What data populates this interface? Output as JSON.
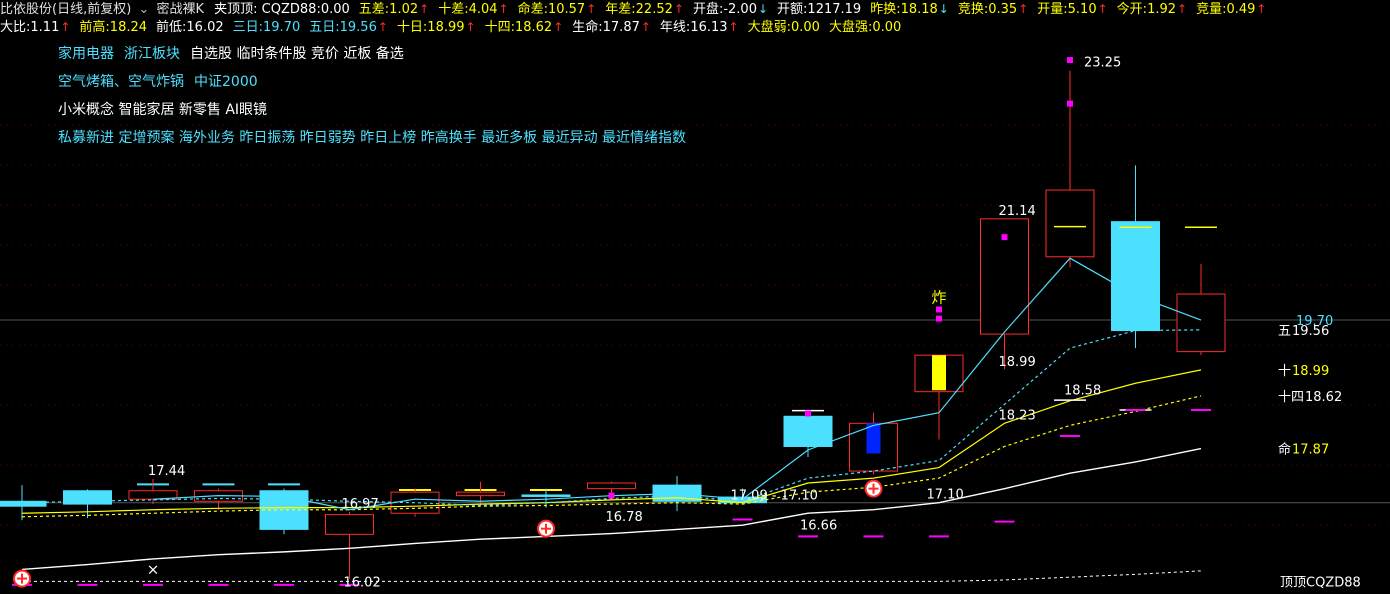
{
  "header": {
    "title": "比依股份(日线,前复权)",
    "indicator_name": "密战裸K",
    "formula_name": "夹顶顶:",
    "row1": [
      {
        "label": "CQZD88:",
        "value": "0.00",
        "color": "#ffffff",
        "arrow": ""
      },
      {
        "label": "五差:",
        "value": "1.02",
        "color": "#ffff00",
        "arrow": "up"
      },
      {
        "label": "十差:",
        "value": "4.04",
        "color": "#ffff00",
        "arrow": "up"
      },
      {
        "label": "命差:",
        "value": "10.57",
        "color": "#ffff00",
        "arrow": "up"
      },
      {
        "label": "年差:",
        "value": "22.52",
        "color": "#ffff00",
        "arrow": "up"
      },
      {
        "label": "开盘:",
        "value": "-2.00",
        "color": "#ffffff",
        "arrow": "down"
      },
      {
        "label": "开额:",
        "value": "1217.19",
        "color": "#ffffff",
        "arrow": ""
      },
      {
        "label": "昨换:",
        "value": "18.18",
        "color": "#ffff00",
        "arrow": "down"
      },
      {
        "label": "竞换:",
        "value": "0.35",
        "color": "#ffff00",
        "arrow": "up"
      },
      {
        "label": "开量:",
        "value": "5.10",
        "color": "#ffff00",
        "arrow": "up"
      },
      {
        "label": "今开:",
        "value": "1.92",
        "color": "#ffff00",
        "arrow": "up"
      },
      {
        "label": "竞量:",
        "value": "0.49",
        "color": "#ffff00",
        "arrow": "up"
      }
    ],
    "row2": [
      {
        "label": "大比:",
        "value": "1.11",
        "color": "#ffffff",
        "arrow": "up"
      },
      {
        "label": "前高:",
        "value": "18.24",
        "color": "#ffff00",
        "arrow": ""
      },
      {
        "label": "前低:",
        "value": "16.02",
        "color": "#ffffff",
        "arrow": ""
      },
      {
        "label": "三日:",
        "value": "19.70",
        "color": "#4ce0ff",
        "arrow": ""
      },
      {
        "label": "五日:",
        "value": "19.56",
        "color": "#4ce0ff",
        "arrow": "up"
      },
      {
        "label": "十日:",
        "value": "18.99",
        "color": "#ffff00",
        "arrow": "up"
      },
      {
        "label": "十四:",
        "value": "18.62",
        "color": "#ffff00",
        "arrow": "up"
      },
      {
        "label": "生命:",
        "value": "17.87",
        "color": "#ffffff",
        "arrow": "up"
      },
      {
        "label": "年线:",
        "value": "16.13",
        "color": "#ffffff",
        "arrow": "up"
      },
      {
        "label": "大盘弱:",
        "value": "0.00",
        "color": "#ffff00",
        "arrow": ""
      },
      {
        "label": "大盘强:",
        "value": "0.00",
        "color": "#ffff00",
        "arrow": ""
      }
    ],
    "arrow_up": "↑",
    "arrow_down": "↓"
  },
  "tags": [
    [
      {
        "text": "家用电器",
        "color": "#4ce0ff"
      },
      {
        "text": "浙江板块",
        "color": "#4ce0ff"
      },
      {
        "text": "自选股 临时条件股 竞价 近板 备选",
        "color": "#ffffff"
      }
    ],
    [
      {
        "text": "空气烤箱、空气炸锅",
        "color": "#4ce0ff"
      },
      {
        "text": "中证2000",
        "color": "#4ce0ff"
      }
    ],
    [
      {
        "text": "小米概念 智能家居 新零售 AI眼镜",
        "color": "#ffffff"
      }
    ],
    [
      {
        "text": "私募新进 定增预案 海外业务 昨日振荡 昨日弱势 昨日上榜 昨高换手 最近多板 最近异动 最近情绪指数",
        "color": "#4ce0ff"
      }
    ]
  ],
  "chart_data": {
    "type": "candlestick",
    "ylim": [
      15.9,
      23.6
    ],
    "colors": {
      "up": "#ff2a2a",
      "down": "#4ce0ff",
      "ma3": "#4ce0ff",
      "ma5": "#4ce0ff",
      "ma10": "#ffff00",
      "ma14": "#ffff00",
      "life": "#ffffff",
      "year": "#ffffff",
      "marker": "#ff00ff"
    },
    "candles": [
      {
        "o": 17.12,
        "c": 17.05,
        "h": 17.35,
        "l": 16.85
      },
      {
        "o": 17.27,
        "c": 17.08,
        "h": 17.29,
        "l": 16.88
      },
      {
        "o": 17.15,
        "c": 17.27,
        "h": 17.44,
        "l": 17.08
      },
      {
        "o": 17.12,
        "c": 17.27,
        "h": 17.3,
        "l": 17.0
      },
      {
        "o": 17.27,
        "c": 16.72,
        "h": 17.3,
        "l": 16.65
      },
      {
        "o": 16.65,
        "c": 16.93,
        "h": 16.97,
        "l": 16.02
      },
      {
        "o": 16.95,
        "c": 17.25,
        "h": 17.3,
        "l": 16.9
      },
      {
        "o": 17.2,
        "c": 17.25,
        "h": 17.4,
        "l": 17.05
      },
      {
        "o": 17.21,
        "c": 17.2,
        "h": 17.3,
        "l": 17.03
      },
      {
        "o": 17.3,
        "c": 17.38,
        "h": 17.4,
        "l": 17.15
      },
      {
        "o": 17.35,
        "c": 17.12,
        "h": 17.48,
        "l": 16.98
      },
      {
        "o": 17.18,
        "c": 17.1,
        "h": 17.3,
        "l": 17.09
      },
      {
        "o": 18.33,
        "c": 17.9,
        "h": 18.35,
        "l": 17.75
      },
      {
        "o": 17.55,
        "c": 18.23,
        "h": 18.38,
        "l": 17.5
      },
      {
        "o": 18.68,
        "c": 19.2,
        "h": 19.2,
        "l": 18.0
      },
      {
        "o": 19.5,
        "c": 21.14,
        "h": 21.14,
        "l": 19.0
      },
      {
        "o": 20.6,
        "c": 21.55,
        "h": 23.25,
        "l": 20.45
      },
      {
        "o": 21.1,
        "c": 19.55,
        "h": 21.9,
        "l": 19.3
      },
      {
        "o": 19.25,
        "c": 20.07,
        "h": 20.5,
        "l": 19.2
      }
    ],
    "special_bodies": [
      {
        "index": 13,
        "color": "#0022ff",
        "o": 17.8,
        "c": 18.23
      },
      {
        "index": 14,
        "color": "#ffff00",
        "o": 18.7,
        "c": 19.2
      }
    ],
    "ma3": [
      null,
      null,
      17.15,
      17.2,
      17.19,
      17.0,
      17.15,
      17.12,
      17.15,
      17.2,
      17.23,
      17.15,
      17.85,
      18.2,
      18.38,
      19.53,
      20.58,
      20.05,
      19.7
    ],
    "ma5": [
      17.1,
      17.12,
      17.14,
      17.16,
      17.15,
      17.12,
      17.1,
      17.06,
      17.1,
      17.16,
      17.2,
      17.12,
      17.45,
      17.55,
      17.7,
      18.5,
      19.3,
      19.55,
      19.56
    ],
    "ma10": [
      16.95,
      16.97,
      17.0,
      17.02,
      17.03,
      17.03,
      17.05,
      17.08,
      17.1,
      17.14,
      17.17,
      17.1,
      17.38,
      17.45,
      17.6,
      18.23,
      18.55,
      18.8,
      18.99
    ],
    "ma14": [
      16.9,
      16.92,
      16.95,
      16.98,
      17.0,
      17.0,
      17.02,
      17.05,
      17.06,
      17.08,
      17.1,
      17.08,
      17.25,
      17.32,
      17.45,
      17.9,
      18.2,
      18.4,
      18.62
    ],
    "life": [
      16.15,
      16.22,
      16.3,
      16.36,
      16.4,
      16.45,
      16.52,
      16.58,
      16.62,
      16.66,
      16.72,
      16.78,
      16.95,
      17.0,
      17.1,
      17.3,
      17.52,
      17.68,
      17.87
    ],
    "year_line": [
      15.98,
      15.98,
      15.98,
      15.98,
      15.98,
      15.98,
      15.98,
      15.98,
      15.98,
      15.98,
      15.98,
      15.98,
      15.98,
      15.98,
      15.98,
      16.0,
      16.04,
      16.08,
      16.13
    ],
    "resistance_dashes": [
      {
        "from": 2,
        "to": 4,
        "value": 17.36,
        "color": "#4ce0ff"
      },
      {
        "from": 6,
        "to": 8,
        "value": 17.28,
        "color": "#ffff00"
      }
    ],
    "mini_dashes": [
      {
        "index": 12,
        "value": 18.41,
        "color": "#ffffff"
      },
      {
        "index": 16,
        "value": 21.03,
        "color": "#ffff00"
      },
      {
        "index": 17,
        "value": 21.02,
        "color": "#ffff00"
      },
      {
        "index": 18,
        "value": 21.02,
        "color": "#ffff00"
      },
      {
        "index": 17,
        "value": 18.42,
        "color": "#ffffff"
      },
      {
        "index": 16,
        "value": 18.56,
        "color": "#ffffff"
      }
    ],
    "magenta_dashes": [
      {
        "index": 0,
        "value": 15.93
      },
      {
        "index": 1,
        "value": 15.93
      },
      {
        "index": 2,
        "value": 15.93
      },
      {
        "index": 3,
        "value": 15.93
      },
      {
        "index": 4,
        "value": 15.93
      },
      {
        "index": 5,
        "value": 15.93
      },
      {
        "index": 11,
        "value": 16.86
      },
      {
        "index": 12,
        "value": 16.62
      },
      {
        "index": 13,
        "value": 16.62
      },
      {
        "index": 14,
        "value": 16.62
      },
      {
        "index": 15,
        "value": 16.83
      },
      {
        "index": 16,
        "value": 18.05
      },
      {
        "index": 17,
        "value": 18.42
      },
      {
        "index": 18,
        "value": 18.42
      }
    ],
    "magenta_squares": [
      {
        "index": 9,
        "value": 17.2
      },
      {
        "index": 12,
        "value": 18.37
      },
      {
        "index": 14,
        "value": 19.72
      },
      {
        "index": 14,
        "value": 19.85
      },
      {
        "index": 15,
        "value": 20.88
      },
      {
        "index": 16,
        "value": 22.78
      },
      {
        "index": 16,
        "value": 23.4
      }
    ],
    "signal_markers": [
      {
        "index": 0,
        "value": 16.02
      },
      {
        "index": 8,
        "value": 16.73
      },
      {
        "index": 13,
        "value": 17.3
      }
    ],
    "text_marks": [
      {
        "text": "×",
        "index": 2,
        "value": 16.08,
        "color": "#ffffff"
      },
      {
        "text": "炸",
        "index": 14,
        "value": 19.95,
        "color": "#ffff00"
      }
    ],
    "value_labels": [
      {
        "text": "17.44",
        "index": 2,
        "value": 17.44,
        "dx": -5,
        "color": "#ffffff"
      },
      {
        "text": "16.97",
        "index": 5,
        "value": 16.97,
        "dx": -8,
        "color": "#ffffff"
      },
      {
        "text": "16.02",
        "index": 5,
        "value": 16.02,
        "dx": -6,
        "dy": 12,
        "color": "#ffffff"
      },
      {
        "text": "16.78",
        "index": 9,
        "value": 16.78,
        "dx": -6,
        "color": "#ffffff"
      },
      {
        "text": "17.09 - 17.10",
        "index": 11,
        "value": 17.09,
        "dx": -12,
        "color": "#ffffff"
      },
      {
        "text": "16.66",
        "index": 12,
        "value": 16.66,
        "dx": -8,
        "color": "#ffffff"
      },
      {
        "text": "17.10",
        "index": 15,
        "value": 17.1,
        "dx": -78,
        "color": "#ffffff"
      },
      {
        "text": "18.99",
        "index": 15,
        "value": 18.99,
        "dx": -6,
        "color": "#ffffff"
      },
      {
        "text": "18.23",
        "index": 15,
        "value": 18.23,
        "dx": -6,
        "color": "#ffffff"
      },
      {
        "text": "21.14",
        "index": 15,
        "value": 21.14,
        "dx": -6,
        "color": "#ffffff"
      },
      {
        "text": "23.25",
        "index": 16,
        "value": 23.25,
        "dx": 14,
        "color": "#ffffff"
      },
      {
        "text": "18.58",
        "index": 16,
        "value": 18.58,
        "dx": -6,
        "color": "#ffffff"
      }
    ],
    "right_labels": [
      {
        "text": "19.70",
        "value": 19.7,
        "prefix": "",
        "color": "#4ce0ff"
      },
      {
        "text": "19.56",
        "value": 19.56,
        "prefix": "五",
        "color": "#ffffff"
      },
      {
        "text": "18.99",
        "value": 18.99,
        "prefix": "十",
        "color": "#ffff00"
      },
      {
        "text": "18.62",
        "value": 18.62,
        "prefix": "十四",
        "color": "#ffffff"
      },
      {
        "text": "17.87",
        "value": 17.87,
        "prefix": "命",
        "color": "#ffff00"
      },
      {
        "text": "顶顶CQZD88",
        "value": 15.98,
        "prefix": "",
        "color": "#ffffff"
      }
    ],
    "ref_lines": [
      19.7,
      17.1
    ]
  }
}
